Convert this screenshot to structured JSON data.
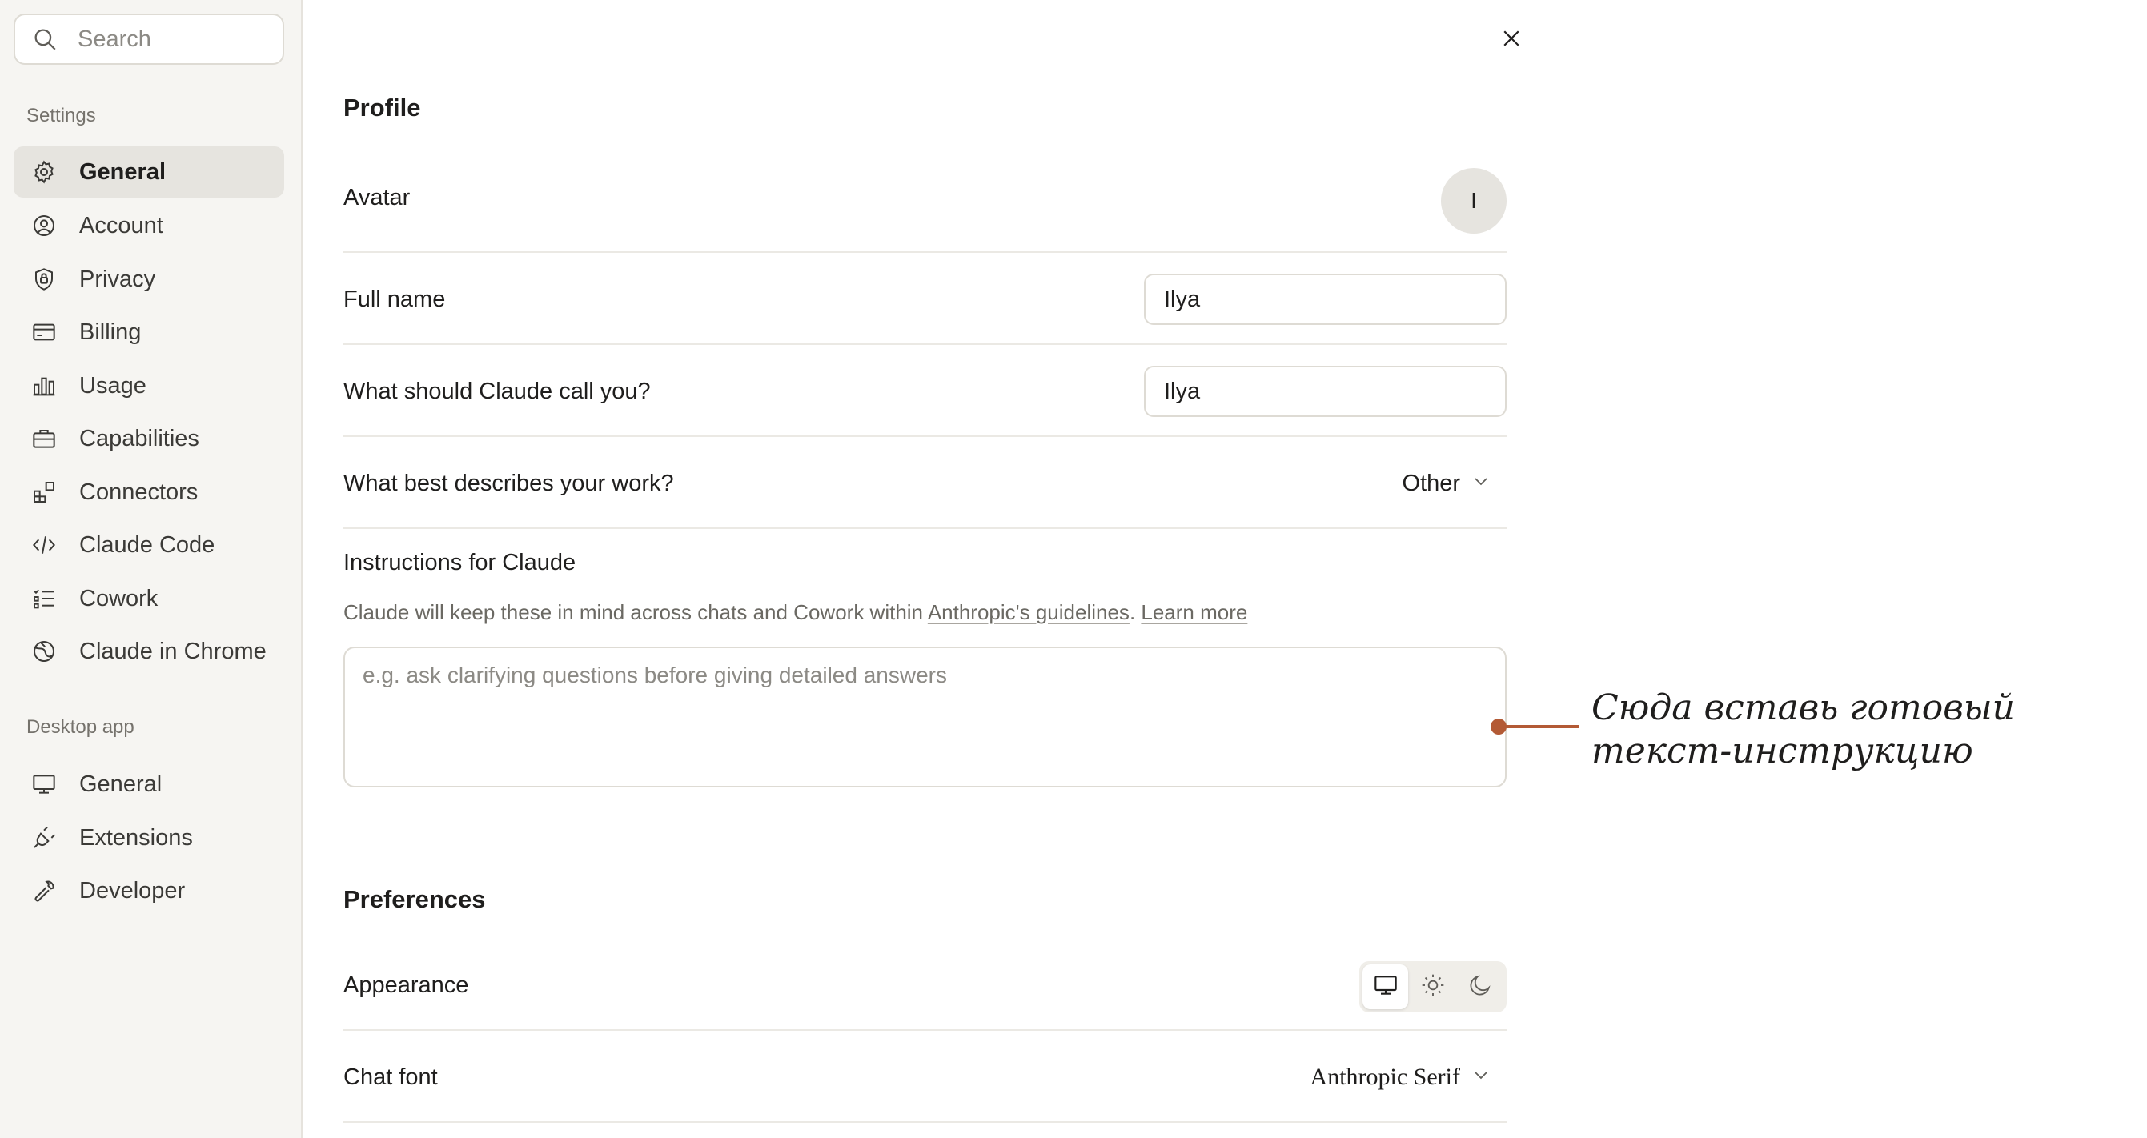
{
  "sidebar": {
    "search": {
      "placeholder": "Search"
    },
    "settings_label": "Settings",
    "settings_items": [
      {
        "label": "General",
        "icon": "gear-icon",
        "active": true
      },
      {
        "label": "Account",
        "icon": "user-circle-icon"
      },
      {
        "label": "Privacy",
        "icon": "shield-lock-icon"
      },
      {
        "label": "Billing",
        "icon": "credit-card-icon"
      },
      {
        "label": "Usage",
        "icon": "bar-chart-icon"
      },
      {
        "label": "Capabilities",
        "icon": "briefcase-icon"
      },
      {
        "label": "Connectors",
        "icon": "blocks-icon"
      },
      {
        "label": "Claude Code",
        "icon": "code-icon"
      },
      {
        "label": "Cowork",
        "icon": "checklist-icon"
      },
      {
        "label": "Claude in Chrome",
        "icon": "globe-icon"
      }
    ],
    "desktop_label": "Desktop app",
    "desktop_items": [
      {
        "label": "General",
        "icon": "monitor-icon"
      },
      {
        "label": "Extensions",
        "icon": "plug-icon"
      },
      {
        "label": "Developer",
        "icon": "wrench-icon"
      }
    ]
  },
  "profile": {
    "title": "Profile",
    "avatar_label": "Avatar",
    "avatar_initial": "I",
    "full_name_label": "Full name",
    "full_name_value": "Ilya",
    "call_you_label": "What should Claude call you?",
    "call_you_value": "Ilya",
    "work_label": "What best describes your work?",
    "work_value": "Other",
    "instructions_title": "Instructions for Claude",
    "instructions_desc_prefix": "Claude will keep these in mind across chats and Cowork within ",
    "instructions_desc_link1": "Anthropic's guidelines",
    "instructions_desc_sep": ". ",
    "instructions_desc_link2": "Learn more",
    "instructions_placeholder": "e.g. ask clarifying questions before giving detailed answers"
  },
  "annotation": {
    "line1": "Сюда вставь готовый",
    "line2": "текст-инструкцию",
    "color": "#b35a35"
  },
  "preferences": {
    "title": "Preferences",
    "appearance_label": "Appearance",
    "appearance_options": [
      "monitor-icon",
      "sun-icon",
      "moon-icon"
    ],
    "appearance_selected": "monitor-icon",
    "chat_font_label": "Chat font",
    "chat_font_value": "Anthropic Serif"
  }
}
